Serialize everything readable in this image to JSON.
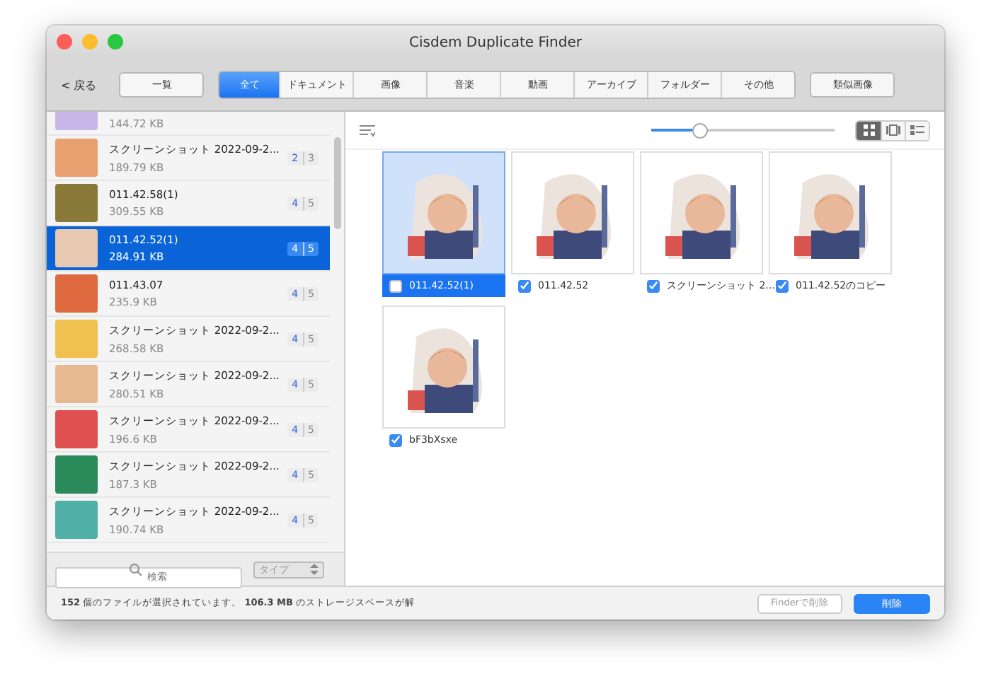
{
  "window": {
    "title": "Cisdem Duplicate Finder"
  },
  "toolbar": {
    "back": "< 戻る",
    "overview": "一覧",
    "similar": "類似画像",
    "tabs": [
      {
        "label": "全て",
        "selected": true
      },
      {
        "label": "ドキュメント",
        "selected": false
      },
      {
        "label": "画像",
        "selected": false
      },
      {
        "label": "音楽",
        "selected": false
      },
      {
        "label": "動画",
        "selected": false
      },
      {
        "label": "アーカイブ",
        "selected": false
      },
      {
        "label": "フォルダー",
        "selected": false
      },
      {
        "label": "その他",
        "selected": false
      }
    ]
  },
  "groups": [
    {
      "size": "144.72 KB",
      "selected": false,
      "color": "#c9b6e8"
    },
    {
      "name": "スクリーンショット 2022-09-2...",
      "size": "189.79 KB",
      "count_a": "2",
      "count_b": "3",
      "selected": false,
      "color": "#e8a070"
    },
    {
      "name": "011.42.58(1)",
      "size": "309.55 KB",
      "count_a": "4",
      "count_b": "5",
      "selected": false,
      "color": "#8a7a3a"
    },
    {
      "name": "011.42.52(1)",
      "size": "284.91 KB",
      "count_a": "4",
      "count_b": "5",
      "selected": true,
      "color": "#e8c8b0"
    },
    {
      "name": "011.43.07",
      "size": "235.9 KB",
      "count_a": "4",
      "count_b": "5",
      "selected": false,
      "color": "#e06a40"
    },
    {
      "name": "スクリーンショット 2022-09-2...",
      "size": "268.58 KB",
      "count_a": "4",
      "count_b": "5",
      "selected": false,
      "color": "#f0c050"
    },
    {
      "name": "スクリーンショット 2022-09-2...",
      "size": "280.51 KB",
      "count_a": "4",
      "count_b": "5",
      "selected": false,
      "color": "#e8b890"
    },
    {
      "name": "スクリーンショット 2022-09-2...",
      "size": "196.6 KB",
      "count_a": "4",
      "count_b": "5",
      "selected": false,
      "color": "#e05050"
    },
    {
      "name": "スクリーンショット 2022-09-2...",
      "size": "187.3 KB",
      "count_a": "4",
      "count_b": "5",
      "selected": false,
      "color": "#2a8a5a"
    },
    {
      "name": "スクリーンショット 2022-09-2...",
      "size": "190.74 KB",
      "count_a": "4",
      "count_b": "5",
      "selected": false,
      "color": "#50b0a8"
    }
  ],
  "search": {
    "placeholder": "検索"
  },
  "type_select": {
    "value": "タイプ"
  },
  "preview": {
    "zoom": {
      "level": 0.27
    },
    "views": [
      {
        "kind": "grid",
        "selected": true
      },
      {
        "kind": "film",
        "selected": false
      },
      {
        "kind": "list",
        "selected": false
      }
    ],
    "files": [
      {
        "name": "011.42.52(1)",
        "checked": false,
        "selected": true
      },
      {
        "name": "011.42.52",
        "checked": true,
        "selected": false
      },
      {
        "name": "スクリーンショット 2...",
        "checked": true,
        "selected": false
      },
      {
        "name": "011.42.52のコピー",
        "checked": true,
        "selected": false
      },
      {
        "name": "bF3bXsxe",
        "checked": true,
        "selected": false
      }
    ]
  },
  "status_bar": {
    "text": "**152** 個のファイルが選択されています。 **106.3 MB** のストレージスペースが解",
    "finder_delete": "Finderで削除",
    "delete": "削除"
  }
}
